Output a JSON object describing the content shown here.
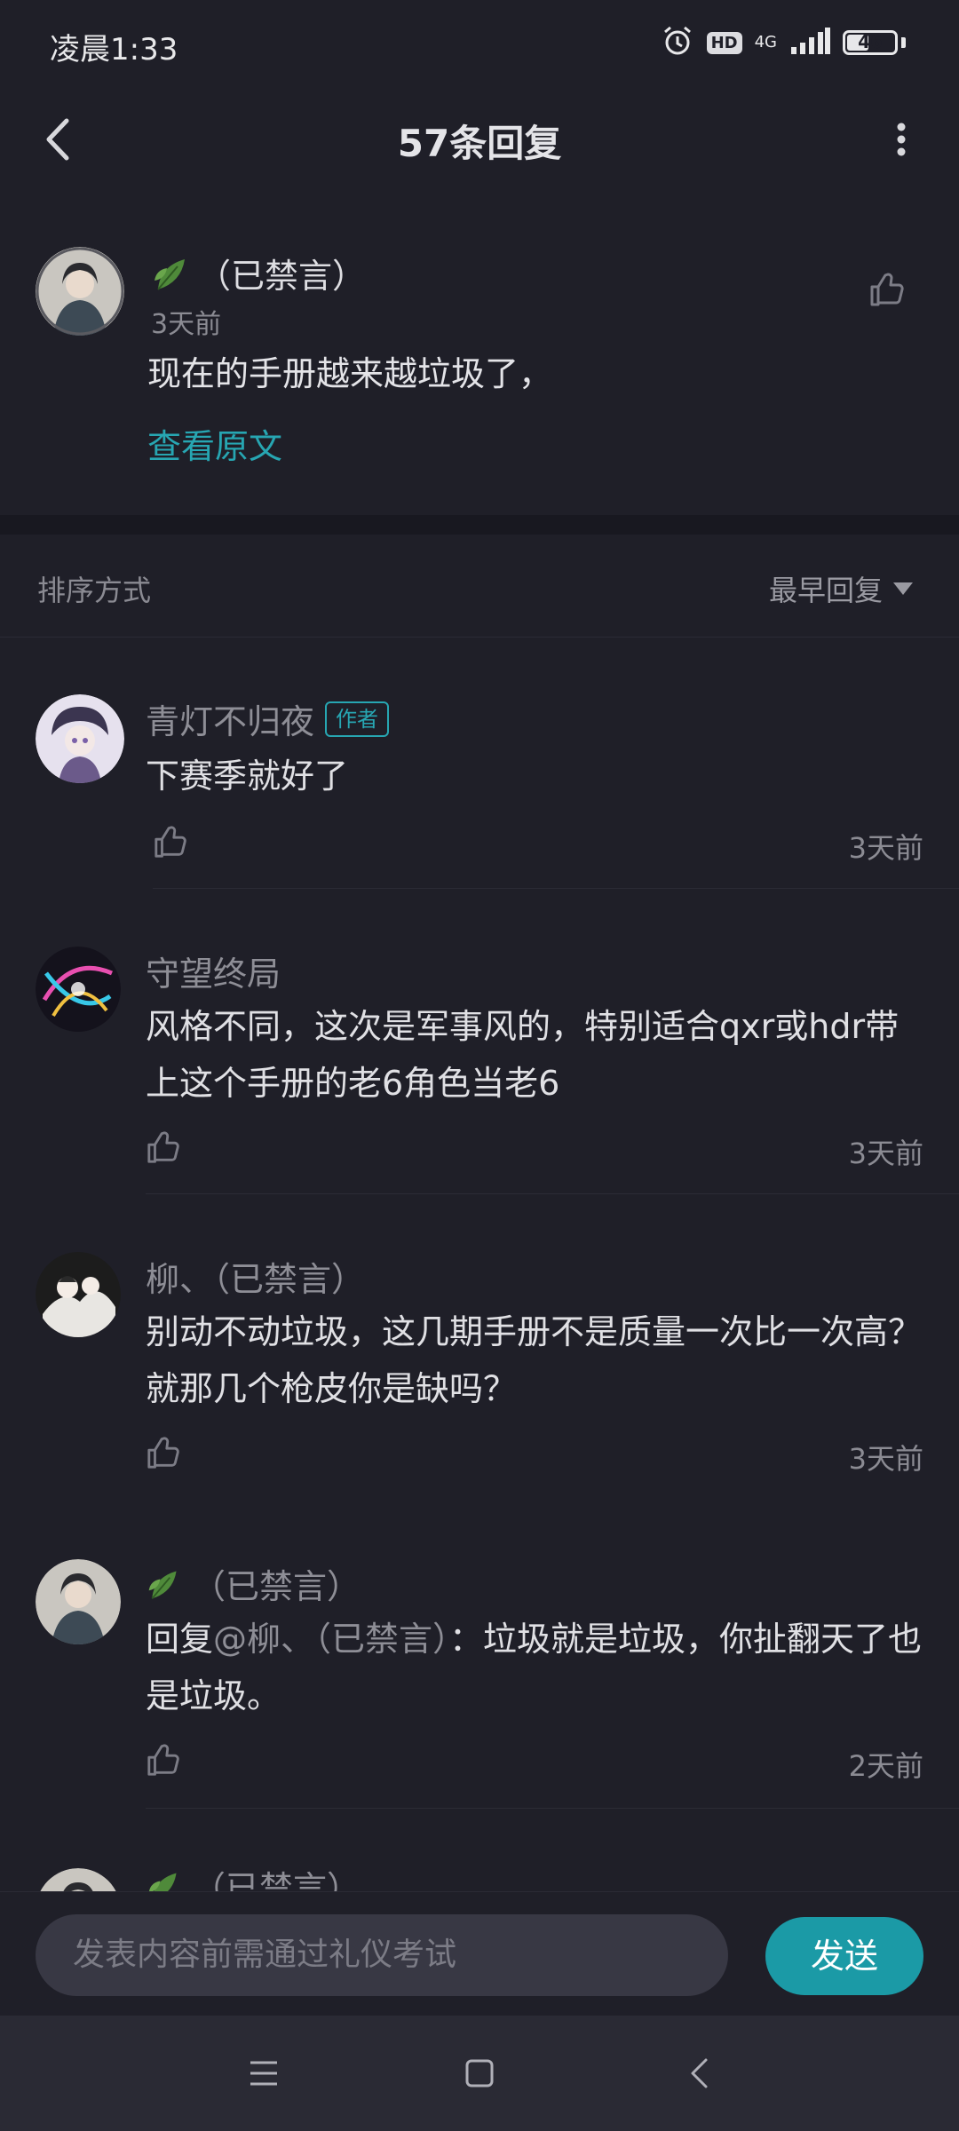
{
  "status_bar": {
    "time": "凌晨1:33",
    "hd": "HD",
    "network": "4G",
    "battery": "46",
    "battery_level": 0.46
  },
  "header": {
    "title": "57条回复",
    "back_icon": "chevron-left-icon",
    "more_icon": "more-vertical-icon"
  },
  "original_post": {
    "username": "（已禁言）",
    "username_icon": "leaf-icon",
    "time": "3天前",
    "content": "现在的手册越来越垃圾了，",
    "view_original": "查看原文",
    "like_icon": "thumbs-up-icon"
  },
  "sort": {
    "label": "排序方式",
    "value": "最早回复",
    "icon": "caret-down-icon"
  },
  "replies": [
    {
      "username": "青灯不归夜",
      "badge": "作者",
      "content": "下赛季就好了",
      "time": "3天前"
    },
    {
      "username": "守望终局",
      "content": "风格不同，这次是军事风的，特别适合qxr或hdr带上这个手册的老6角色当老6",
      "time": "3天前"
    },
    {
      "username": "柳、（已禁言）",
      "content": "别动不动垃圾，这几期手册不是质量一次比一次高？就那几个枪皮你是缺吗？",
      "time": "3天前"
    },
    {
      "username": "（已禁言）",
      "reply_prefix": "回复",
      "mention": "@柳、（已禁言）",
      "content": "：垃圾就是垃圾，你扯翻天了也是垃圾。",
      "time": "2天前"
    },
    {
      "username": "（已禁言）"
    }
  ],
  "composer": {
    "placeholder": "发表内容前需通过礼仪考试",
    "send_label": "发送"
  },
  "nav": {
    "menu_icon": "menu-icon",
    "home_icon": "square-home-icon",
    "back_icon": "triangle-back-icon"
  },
  "colors": {
    "background": "#1f1f28",
    "accent": "#27a6b2",
    "send_button": "#1b9aa6",
    "muted_text": "#8b8b93"
  }
}
